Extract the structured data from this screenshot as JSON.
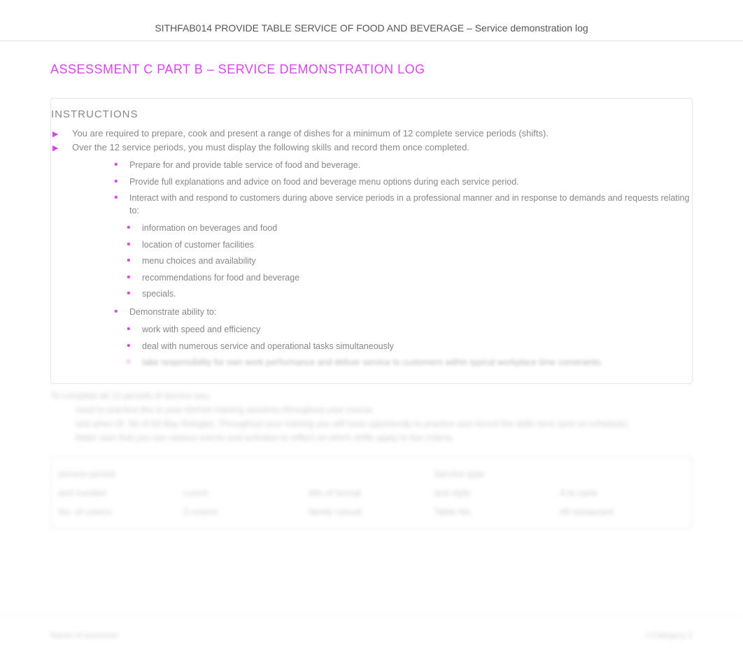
{
  "header": {
    "title": "SITHFAB014 PROVIDE TABLE SERVICE OF FOOD AND BEVERAGE – Service demonstration log"
  },
  "main": {
    "title": "ASSESSMENT C PART B – SERVICE DEMONSTRATION LOG",
    "instructions_heading": "INSTRUCTIONS",
    "arrow_items": [
      "You are required to prepare, cook and present a range of dishes for a minimum of 12 complete service periods (shifts).",
      "Over the 12 service periods, you must display the following skills and record them once completed."
    ],
    "level1_items": [
      "Prepare for and provide table service of food and beverage.",
      "Provide full explanations and advice on food and beverage menu options during each service period.",
      "Interact with and respond to customers during above service periods in a professional manner and in response to demands and requests relating to:"
    ],
    "level2_items_a": [
      "information on beverages and food",
      "location of customer facilities",
      "menu choices and availability",
      "recommendations for food and beverage",
      "specials."
    ],
    "level1_item_demo": "Demonstrate ability to:",
    "level2_items_b": [
      "work with speed and efficiency",
      "deal with numerous service and operational tasks simultaneously"
    ],
    "blurred_bullet": "take responsibility for own work performance and deliver service to customers within typical workplace time constraints."
  },
  "blurred": {
    "line1": "To complete all 12 periods of service you:",
    "line2": "need to practice this in your kitchen training sessions throughout your course",
    "line3": "and when (if. Sb of Kit Bay Rologie). Throughout your training you will have opportunity to practice and record the skills here (and on schedule).",
    "line4": "Make sure that you use various events and activities to reflect on which shifts apply to this criteria."
  },
  "table": {
    "row1": [
      "service period",
      "",
      "",
      "Service type",
      ""
    ],
    "row2": [
      "and number",
      "Lunch",
      "Mix of formal ",
      "and style",
      "A la carte"
    ],
    "row3": [
      "No. of covers",
      "3 covers",
      "family casual",
      "Table No.",
      "All restaurant"
    ]
  },
  "footer": {
    "left": "Name of assessor",
    "right": "J Category 2"
  }
}
